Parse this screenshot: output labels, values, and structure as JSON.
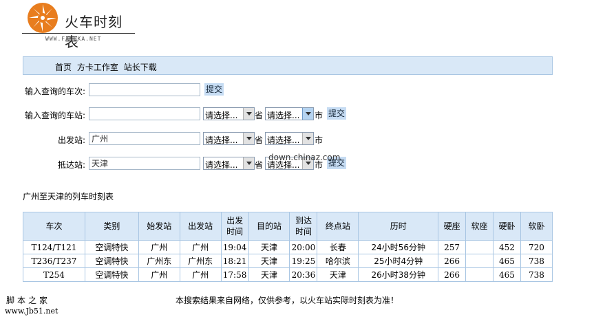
{
  "logo": {
    "title": "火车时刻表",
    "url": "WWW.FANGKA.NET"
  },
  "nav": {
    "links": [
      "首页",
      "方卡工作室",
      "站长下载"
    ]
  },
  "form": {
    "train_no": {
      "label": "输入查询的车次:",
      "value": "",
      "submit": "提交"
    },
    "station": {
      "label": "输入查询的车站:",
      "value": "",
      "province_select": "请选择...",
      "province_unit": "省",
      "city_select": "请选择...",
      "city_unit": "市",
      "submit": "提交"
    },
    "depart": {
      "label": "出发站:",
      "value": "广州",
      "province_select": "请选择...",
      "province_unit": "省",
      "city_select": "请选择...",
      "city_unit": "市"
    },
    "arrive": {
      "label": "抵达站:",
      "value": "天津",
      "province_select": "请选择...",
      "province_unit": "省",
      "city_select": "请选择...",
      "city_unit": "市",
      "submit": "提交"
    }
  },
  "watermark": "down.chinaz.com",
  "results": {
    "title": "广州至天津的列车时刻表",
    "headers": [
      "车次",
      "类别",
      "始发站",
      "出发站",
      "出发\n时间",
      "目的站",
      "到达\n时间",
      "终点站",
      "历时",
      "硬座",
      "软座",
      "硬卧",
      "软卧"
    ],
    "rows": [
      [
        "T124/T121",
        "空调特快",
        "广州",
        "广州",
        "19:04",
        "天津",
        "20:00",
        "长春",
        "24小时56分钟",
        "257",
        "",
        "452",
        "720"
      ],
      [
        "T236/T237",
        "空调特快",
        "广州东",
        "广州东",
        "18:21",
        "天津",
        "19:25",
        "哈尔滨",
        "25小时4分钟",
        "266",
        "",
        "465",
        "738"
      ],
      [
        "T254",
        "空调特快",
        "广州",
        "广州",
        "17:58",
        "天津",
        "20:36",
        "天津",
        "26小时38分钟",
        "266",
        "",
        "465",
        "738"
      ]
    ]
  },
  "footer_note": "本搜索结果来自网络，仅供参考，以火车站实际时刻表为准！",
  "corner": {
    "title": "脚本之家",
    "url": "www.Jb51.net"
  },
  "colors": {
    "header_bg": "#d9e8f7",
    "border": "#a9c6e3",
    "button_bg": "#c6dcf3",
    "logo_orange": "#e87d1e"
  }
}
